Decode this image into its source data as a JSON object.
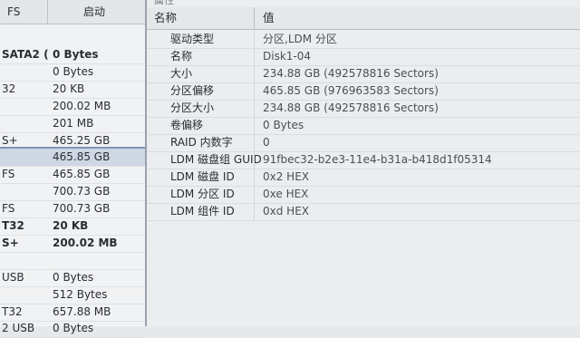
{
  "left_panel": {
    "header": {
      "col1": "FS",
      "col2": "启动"
    },
    "rows": [
      {
        "fs": "SATA2 (...",
        "size": "0 Bytes",
        "bold": true
      },
      {
        "fs": "",
        "size": "0 Bytes"
      },
      {
        "fs": "32",
        "size": "20 KB"
      },
      {
        "fs": "",
        "size": "200.02 MB"
      },
      {
        "fs": "",
        "size": "201 MB"
      },
      {
        "fs": "S+",
        "size": "465.25 GB"
      },
      {
        "fs": "",
        "size": "465.85 GB",
        "selected": true
      },
      {
        "fs": "FS",
        "size": "465.85 GB"
      },
      {
        "fs": "",
        "size": "700.73 GB"
      },
      {
        "fs": "FS",
        "size": "700.73 GB"
      },
      {
        "fs": "T32",
        "size": "20 KB",
        "bold": true
      },
      {
        "fs": "S+",
        "size": "200.02 MB",
        "bold": true
      },
      {
        "fs": "",
        "size": ""
      },
      {
        "fs": "USB",
        "size": "0 Bytes"
      },
      {
        "fs": "",
        "size": "512 Bytes"
      },
      {
        "fs": "T32",
        "size": "657.88 MB"
      },
      {
        "fs": "2 USB",
        "size": "0 Bytes"
      }
    ]
  },
  "properties": {
    "panel_title": "属性",
    "header": {
      "name": "名称",
      "value": "值"
    },
    "rows": [
      {
        "name": "驱动类型",
        "value": "分区,LDM 分区"
      },
      {
        "name": "名称",
        "value": "Disk1-04"
      },
      {
        "name": "大小",
        "value": "234.88 GB (492578816 Sectors)"
      },
      {
        "name": "分区偏移",
        "value": "465.85 GB (976963583 Sectors)"
      },
      {
        "name": "分区大小",
        "value": "234.88 GB (492578816 Sectors)"
      },
      {
        "name": "卷偏移",
        "value": "0 Bytes"
      },
      {
        "name": "RAID 内数字",
        "value": "0"
      },
      {
        "name": "LDM 磁盘组 GUID",
        "value": "91fbec32-b2e3-11e4-b31a-b418d1f05314"
      },
      {
        "name": "LDM 磁盘 ID",
        "value": "0x2 HEX"
      },
      {
        "name": "LDM 分区 ID",
        "value": "0xe HEX"
      },
      {
        "name": "LDM 组件 ID",
        "value": "0xd HEX"
      }
    ]
  }
}
